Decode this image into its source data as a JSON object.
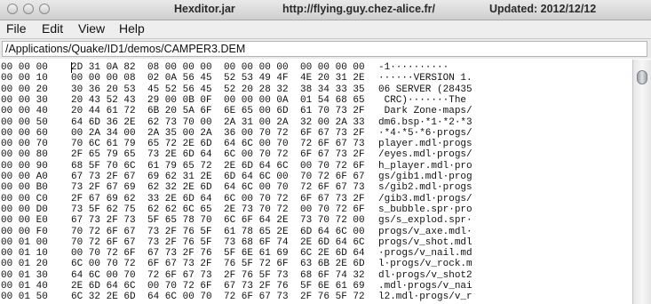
{
  "window": {
    "title": "Hexditor.jar",
    "url": "http://flying.guy.chez-alice.fr/",
    "updated": "Updated: 2012/12/12"
  },
  "menu": {
    "file": "File",
    "edit": "Edit",
    "view": "View",
    "help": "Help"
  },
  "path": "/Applications/Quake/ID1/demos/CAMPER3.DEM",
  "rows": [
    {
      "addr": "00 00 00",
      "g1": "2D 31 0A 82",
      "g2": "08 00 00 00",
      "g3": "00 00 00 00",
      "g4": "00 00 00 00",
      "ascii": "-1··········"
    },
    {
      "addr": "00 00 10",
      "g1": "00 00 00 08",
      "g2": "02 0A 56 45",
      "g3": "52 53 49 4F",
      "g4": "4E 20 31 2E",
      "ascii": "······VERSION 1."
    },
    {
      "addr": "00 00 20",
      "g1": "30 36 20 53",
      "g2": "45 52 56 45",
      "g3": "52 20 28 32",
      "g4": "38 34 33 35",
      "ascii": "06 SERVER (28435"
    },
    {
      "addr": "00 00 30",
      "g1": "20 43 52 43",
      "g2": "29 00 0B 0F",
      "g3": "00 00 00 0A",
      "g4": "01 54 68 65",
      "ascii": " CRC)·······The"
    },
    {
      "addr": "00 00 40",
      "g1": "20 44 61 72",
      "g2": "6B 20 5A 6F",
      "g3": "6E 65 00 6D",
      "g4": "61 70 73 2F",
      "ascii": " Dark Zone·maps/"
    },
    {
      "addr": "00 00 50",
      "g1": "64 6D 36 2E",
      "g2": "62 73 70 00",
      "g3": "2A 31 00 2A",
      "g4": "32 00 2A 33",
      "ascii": "dm6.bsp·*1·*2·*3"
    },
    {
      "addr": "00 00 60",
      "g1": "00 2A 34 00",
      "g2": "2A 35 00 2A",
      "g3": "36 00 70 72",
      "g4": "6F 67 73 2F",
      "ascii": "·*4·*5·*6·progs/"
    },
    {
      "addr": "00 00 70",
      "g1": "70 6C 61 79",
      "g2": "65 72 2E 6D",
      "g3": "64 6C 00 70",
      "g4": "72 6F 67 73",
      "ascii": "player.mdl·progs"
    },
    {
      "addr": "00 00 80",
      "g1": "2F 65 79 65",
      "g2": "73 2E 6D 64",
      "g3": "6C 00 70 72",
      "g4": "6F 67 73 2F",
      "ascii": "/eyes.mdl·progs/"
    },
    {
      "addr": "00 00 90",
      "g1": "68 5F 70 6C",
      "g2": "61 79 65 72",
      "g3": "2E 6D 64 6C",
      "g4": "00 70 72 6F",
      "ascii": "h_player.mdl·pro"
    },
    {
      "addr": "00 00 A0",
      "g1": "67 73 2F 67",
      "g2": "69 62 31 2E",
      "g3": "6D 64 6C 00",
      "g4": "70 72 6F 67",
      "ascii": "gs/gib1.mdl·prog"
    },
    {
      "addr": "00 00 B0",
      "g1": "73 2F 67 69",
      "g2": "62 32 2E 6D",
      "g3": "64 6C 00 70",
      "g4": "72 6F 67 73",
      "ascii": "s/gib2.mdl·progs"
    },
    {
      "addr": "00 00 C0",
      "g1": "2F 67 69 62",
      "g2": "33 2E 6D 64",
      "g3": "6C 00 70 72",
      "g4": "6F 67 73 2F",
      "ascii": "/gib3.mdl·progs/"
    },
    {
      "addr": "00 00 D0",
      "g1": "73 5F 62 75",
      "g2": "62 62 6C 65",
      "g3": "2E 73 70 72",
      "g4": "00 70 72 6F",
      "ascii": "s_bubble.spr·pro"
    },
    {
      "addr": "00 00 E0",
      "g1": "67 73 2F 73",
      "g2": "5F 65 78 70",
      "g3": "6C 6F 64 2E",
      "g4": "73 70 72 00",
      "ascii": "gs/s_explod.spr·"
    },
    {
      "addr": "00 00 F0",
      "g1": "70 72 6F 67",
      "g2": "73 2F 76 5F",
      "g3": "61 78 65 2E",
      "g4": "6D 64 6C 00",
      "ascii": "progs/v_axe.mdl·"
    },
    {
      "addr": "00 01 00",
      "g1": "70 72 6F 67",
      "g2": "73 2F 76 5F",
      "g3": "73 68 6F 74",
      "g4": "2E 6D 64 6C",
      "ascii": "progs/v_shot.mdl"
    },
    {
      "addr": "00 01 10",
      "g1": "00 70 72 6F",
      "g2": "67 73 2F 76",
      "g3": "5F 6E 61 69",
      "g4": "6C 2E 6D 64",
      "ascii": "·progs/v_nail.md"
    },
    {
      "addr": "00 01 20",
      "g1": "6C 00 70 72",
      "g2": "6F 67 73 2F",
      "g3": "76 5F 72 6F",
      "g4": "63 6B 2E 6D",
      "ascii": "l·progs/v_rock.m"
    },
    {
      "addr": "00 01 30",
      "g1": "64 6C 00 70",
      "g2": "72 6F 67 73",
      "g3": "2F 76 5F 73",
      "g4": "68 6F 74 32",
      "ascii": "dl·progs/v_shot2"
    },
    {
      "addr": "00 01 40",
      "g1": "2E 6D 64 6C",
      "g2": "00 70 72 6F",
      "g3": "67 73 2F 76",
      "g4": "5F 6E 61 69",
      "ascii": ".mdl·progs/v_nai"
    },
    {
      "addr": "00 01 50",
      "g1": "6C 32 2E 6D",
      "g2": "64 6C 00 70",
      "g3": "72 6F 67 73",
      "g4": "2F 76 5F 72",
      "ascii": "l2.mdl·progs/v_r"
    }
  ]
}
